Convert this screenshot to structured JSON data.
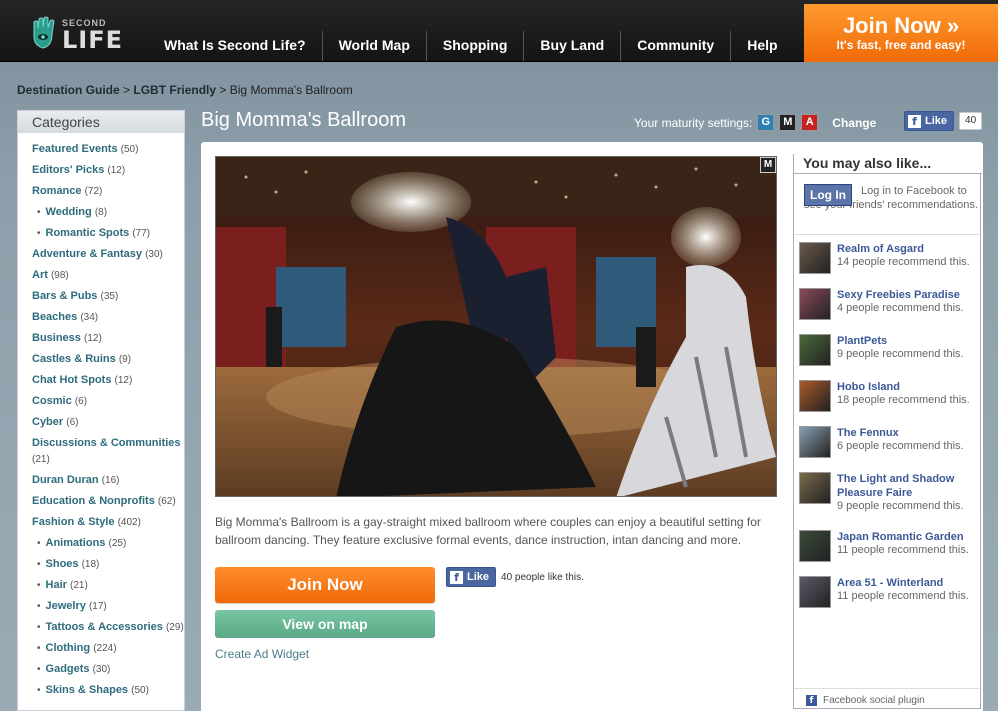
{
  "brand": {
    "second": "SECOND",
    "life": "LIFE"
  },
  "nav": [
    {
      "label": "What Is Second Life?"
    },
    {
      "label": "World Map"
    },
    {
      "label": "Shopping"
    },
    {
      "label": "Buy Land"
    },
    {
      "label": "Community"
    },
    {
      "label": "Help"
    }
  ],
  "join_top": {
    "title": "Join Now »",
    "subtitle": "It's fast, free and easy!"
  },
  "breadcrumb": {
    "item1": "Destination Guide",
    "sep": ">",
    "item2": "LGBT Friendly",
    "current": "Big Momma's Ballroom"
  },
  "sidebar": {
    "heading": "Categories",
    "items": [
      {
        "label": "Featured Events",
        "count": "(50)"
      },
      {
        "label": "Editors' Picks",
        "count": "(12)"
      },
      {
        "label": "Romance",
        "count": "(72)"
      },
      {
        "label": "Wedding",
        "count": "(8)",
        "sub": true
      },
      {
        "label": "Romantic Spots",
        "count": "(77)",
        "sub": true
      },
      {
        "label": "Adventure & Fantasy",
        "count": "(30)"
      },
      {
        "label": "Art",
        "count": "(98)"
      },
      {
        "label": "Bars & Pubs",
        "count": "(35)"
      },
      {
        "label": "Beaches",
        "count": "(34)"
      },
      {
        "label": "Business",
        "count": "(12)"
      },
      {
        "label": "Castles & Ruins",
        "count": "(9)"
      },
      {
        "label": "Chat Hot Spots",
        "count": "(12)"
      },
      {
        "label": "Cosmic",
        "count": "(6)"
      },
      {
        "label": "Cyber",
        "count": "(6)"
      },
      {
        "label": "Discussions & Communities",
        "count": "(21)",
        "wrap": true
      },
      {
        "label": "Duran Duran",
        "count": "(16)"
      },
      {
        "label": "Education & Nonprofits",
        "count": "(62)",
        "wrap": true
      },
      {
        "label": "Fashion & Style",
        "count": "(402)"
      },
      {
        "label": "Animations",
        "count": "(25)",
        "sub": true
      },
      {
        "label": "Shoes",
        "count": "(18)",
        "sub": true
      },
      {
        "label": "Hair",
        "count": "(21)",
        "sub": true
      },
      {
        "label": "Jewelry",
        "count": "(17)",
        "sub": true
      },
      {
        "label": "Tattoos & Accessories",
        "count": "(29)",
        "sub": true,
        "wrap": true
      },
      {
        "label": "Clothing",
        "count": "(224)",
        "sub": true
      },
      {
        "label": "Gadgets",
        "count": "(30)",
        "sub": true
      },
      {
        "label": "Skins & Shapes",
        "count": "(50)",
        "sub": true
      }
    ]
  },
  "page": {
    "title": "Big Momma's Ballroom",
    "maturity_label": "Your maturity settings:",
    "maturity": [
      "G",
      "M",
      "A"
    ],
    "change": "Change",
    "like_label": "Like",
    "like_count": "40",
    "image_badge": "M",
    "description": "Big Momma's Ballroom is a gay-straight mixed ballroom where couples can enjoy a beautiful setting for ballroom dancing. They feature exclusive formal events, dance instruction, intan dancing and more.",
    "join_button": "Join Now",
    "map_button": "View on map",
    "ad_widget": "Create Ad Widget",
    "fb_like_text": "40 people like this."
  },
  "rail": {
    "heading": "You may also like...",
    "login_button": "Log In",
    "login_text": "Log in to Facebook to see your friends' recommendations.",
    "items": [
      {
        "title": "Realm of Asgard",
        "sub": "14 people recommend this."
      },
      {
        "title": "Sexy Freebies Paradise",
        "sub": "4 people recommend this."
      },
      {
        "title": "PlantPets",
        "sub": "9 people recommend this."
      },
      {
        "title": "Hobo Island",
        "sub": "18 people recommend this."
      },
      {
        "title": "The Fennux",
        "sub": "6 people recommend this."
      },
      {
        "title": "The Light and Shadow Pleasure Faire",
        "sub": "9 people recommend this."
      },
      {
        "title": "Japan Romantic Garden",
        "sub": "11 people recommend this."
      },
      {
        "title": "Area 51 - Winterland",
        "sub": "11 people recommend this."
      }
    ],
    "social_plugin": "Facebook social plugin"
  },
  "colors": {
    "accent_orange": "#f06a08",
    "link_teal": "#2e6b7d",
    "facebook_blue": "#3b5998",
    "map_green": "#5aa885"
  }
}
